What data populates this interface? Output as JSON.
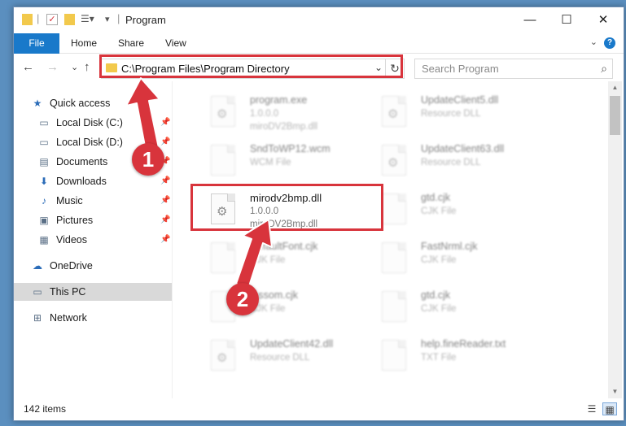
{
  "window": {
    "title": "Program",
    "minimize_glyph": "—",
    "maximize_glyph": "☐",
    "close_glyph": "✕"
  },
  "ribbon": {
    "tabs": [
      "File",
      "Home",
      "Share",
      "View"
    ],
    "help_glyph": "?",
    "collapse_glyph": "⌄"
  },
  "navbar": {
    "back_glyph": "←",
    "forward_glyph": "→",
    "recent_glyph": "⌄",
    "up_glyph": "↑",
    "address": "C:\\Program Files\\Program Directory",
    "dropdown_glyph": "⌄",
    "refresh_glyph": "↻",
    "search_placeholder": "Search Program",
    "search_glyph": "⌕"
  },
  "sidebar": {
    "pin_glyph": "📌",
    "items": [
      {
        "label": "Quick access",
        "icon": "star-icon",
        "glyph": "★",
        "pinned": false
      },
      {
        "label": "Local Disk (C:)",
        "icon": "drive-icon",
        "glyph": "▭",
        "pinned": true
      },
      {
        "label": "Local Disk (D:)",
        "icon": "drive-icon",
        "glyph": "▭",
        "pinned": true
      },
      {
        "label": "Documents",
        "icon": "documents-icon",
        "glyph": "▤",
        "pinned": true
      },
      {
        "label": "Downloads",
        "icon": "downloads-icon",
        "glyph": "⬇",
        "pinned": true
      },
      {
        "label": "Music",
        "icon": "music-icon",
        "glyph": "♪",
        "pinned": true
      },
      {
        "label": "Pictures",
        "icon": "pictures-icon",
        "glyph": "▣",
        "pinned": true
      },
      {
        "label": "Videos",
        "icon": "videos-icon",
        "glyph": "▦",
        "pinned": true
      },
      {
        "label": "OneDrive",
        "icon": "cloud-icon",
        "glyph": "☁",
        "pinned": false
      },
      {
        "label": "This PC",
        "icon": "computer-icon",
        "glyph": "▭",
        "pinned": false,
        "selected": true
      },
      {
        "label": "Network",
        "icon": "network-icon",
        "glyph": "⊞",
        "pinned": false
      }
    ]
  },
  "files": [
    {
      "name": "program.exe",
      "line2": "1.0.0.0",
      "line3": "miroDV2Bmp.dll",
      "gear": true
    },
    {
      "name": "UpdateClient5.dll",
      "line2": "Resource DLL",
      "line3": "",
      "gear": true
    },
    {
      "name": "SndToWP12.wcm",
      "line2": "WCM File",
      "line3": "",
      "gear": false
    },
    {
      "name": "UpdateClient63.dll",
      "line2": "Resource DLL",
      "line3": "",
      "gear": true
    },
    {
      "name": "mirodv2bmp.dll",
      "line2": "1.0.0.0",
      "line3": "miroDV2Bmp.dll",
      "gear": true,
      "highlight": true
    },
    {
      "name": "gtd.cjk",
      "line2": "CJK File",
      "line3": "",
      "gear": false
    },
    {
      "name": "DefaultFont.cjk",
      "line2": "CJK File",
      "line3": "",
      "gear": false
    },
    {
      "name": "FastNrml.cjk",
      "line2": "CJK File",
      "line3": "",
      "gear": false
    },
    {
      "name": "...ssom.cjk",
      "line2": "CJK File",
      "line3": "",
      "gear": false
    },
    {
      "name": "gtd.cjk",
      "line2": "CJK File",
      "line3": "",
      "gear": false
    },
    {
      "name": "UpdateClient42.dll",
      "line2": "Resource DLL",
      "line3": "",
      "gear": true
    },
    {
      "name": "help.fineReader.txt",
      "line2": "TXT File",
      "line3": "",
      "gear": false
    }
  ],
  "scrollbar": {
    "up_glyph": "▲",
    "down_glyph": "▼"
  },
  "status": {
    "item_count": "142 items",
    "details_glyph": "☰",
    "tiles_glyph": "▦"
  },
  "annotations": {
    "step1": "1",
    "step2": "2",
    "accent_color": "#d8343c"
  }
}
